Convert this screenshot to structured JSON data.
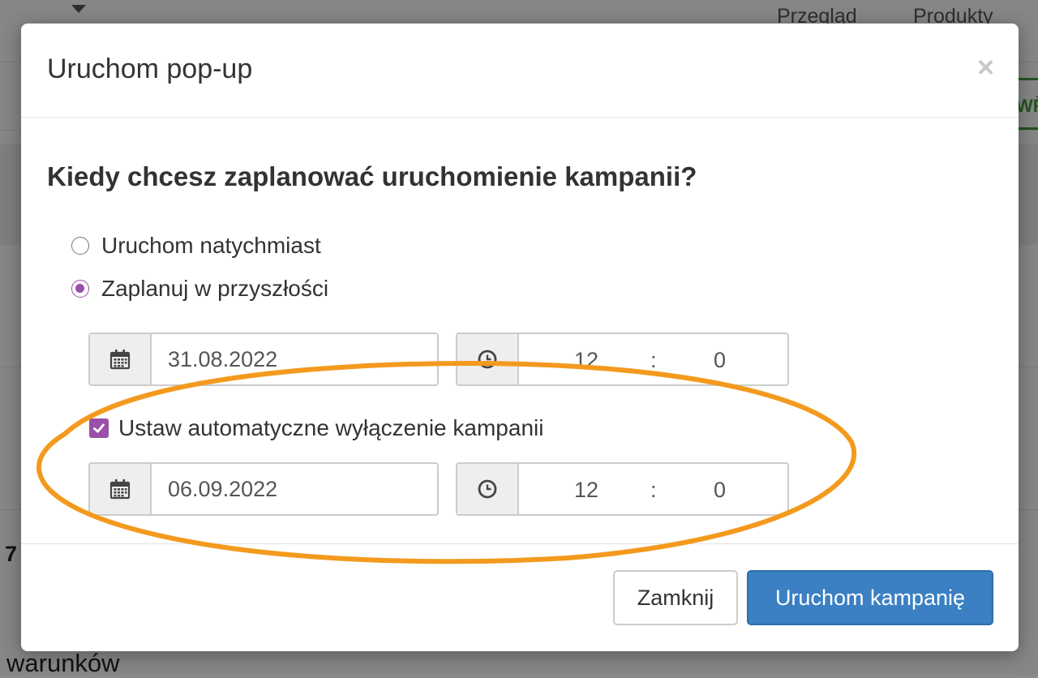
{
  "background": {
    "nav_items": [
      "Przegląd",
      "Produkty"
    ],
    "green_button_label": "WŘ",
    "number_fragment": "7",
    "footer_text": "warunków"
  },
  "modal": {
    "title": "Uruchom pop-up",
    "close_symbol": "×",
    "question": "Kiedy chcesz zaplanować uruchomienie kampanii?",
    "options": [
      {
        "label": "Uruchom natychmiast",
        "checked": false
      },
      {
        "label": "Zaplanuj w przyszłości",
        "checked": true
      }
    ],
    "start": {
      "date": "31.08.2022",
      "hour": "12",
      "separator": ":",
      "minute": "0"
    },
    "auto_off": {
      "label": "Ustaw automatyczne wyłączenie kampanii",
      "checked": true
    },
    "end": {
      "date": "06.09.2022",
      "hour": "12",
      "separator": ":",
      "minute": "0"
    },
    "buttons": {
      "close": "Zamknij",
      "launch": "Uruchom kampanię"
    }
  },
  "icons": {
    "calendar": "calendar-icon",
    "clock": "clock-icon"
  },
  "colors": {
    "accent": "#9a4fa8",
    "primary": "#3a80c2",
    "annotation": "#f39a1e"
  }
}
